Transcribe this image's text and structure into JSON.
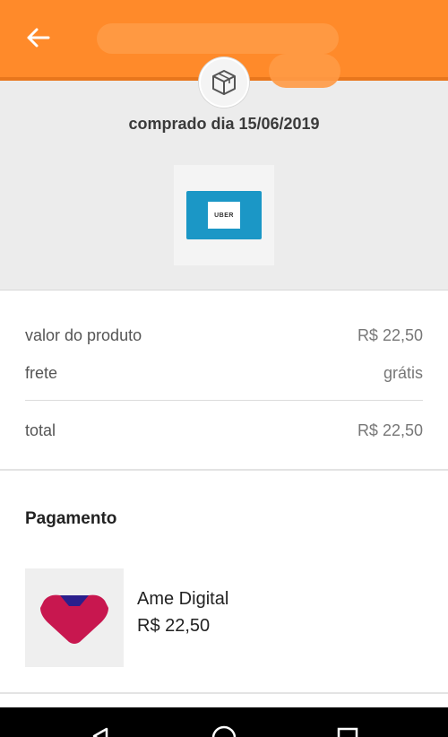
{
  "header": {
    "back_icon": "arrow-left-icon",
    "title_redacted": true,
    "background_color": "#ff8a2a"
  },
  "summary": {
    "status_icon": "box-icon",
    "purchase_date": "comprado dia 15/06/2019",
    "product_image_label": "UBER"
  },
  "prices": {
    "product_label": "valor do produto",
    "product_value": "R$ 22,50",
    "shipping_label": "frete",
    "shipping_value": "grátis",
    "total_label": "total",
    "total_value": "R$ 22,50"
  },
  "payment": {
    "title": "Pagamento",
    "method_name": "Ame Digital",
    "method_amount": "R$ 22,50",
    "method_icon": "ame-heart-logo"
  },
  "system_nav": {
    "back": "nav-back-icon",
    "home": "nav-home-icon",
    "recents": "nav-recents-icon"
  }
}
